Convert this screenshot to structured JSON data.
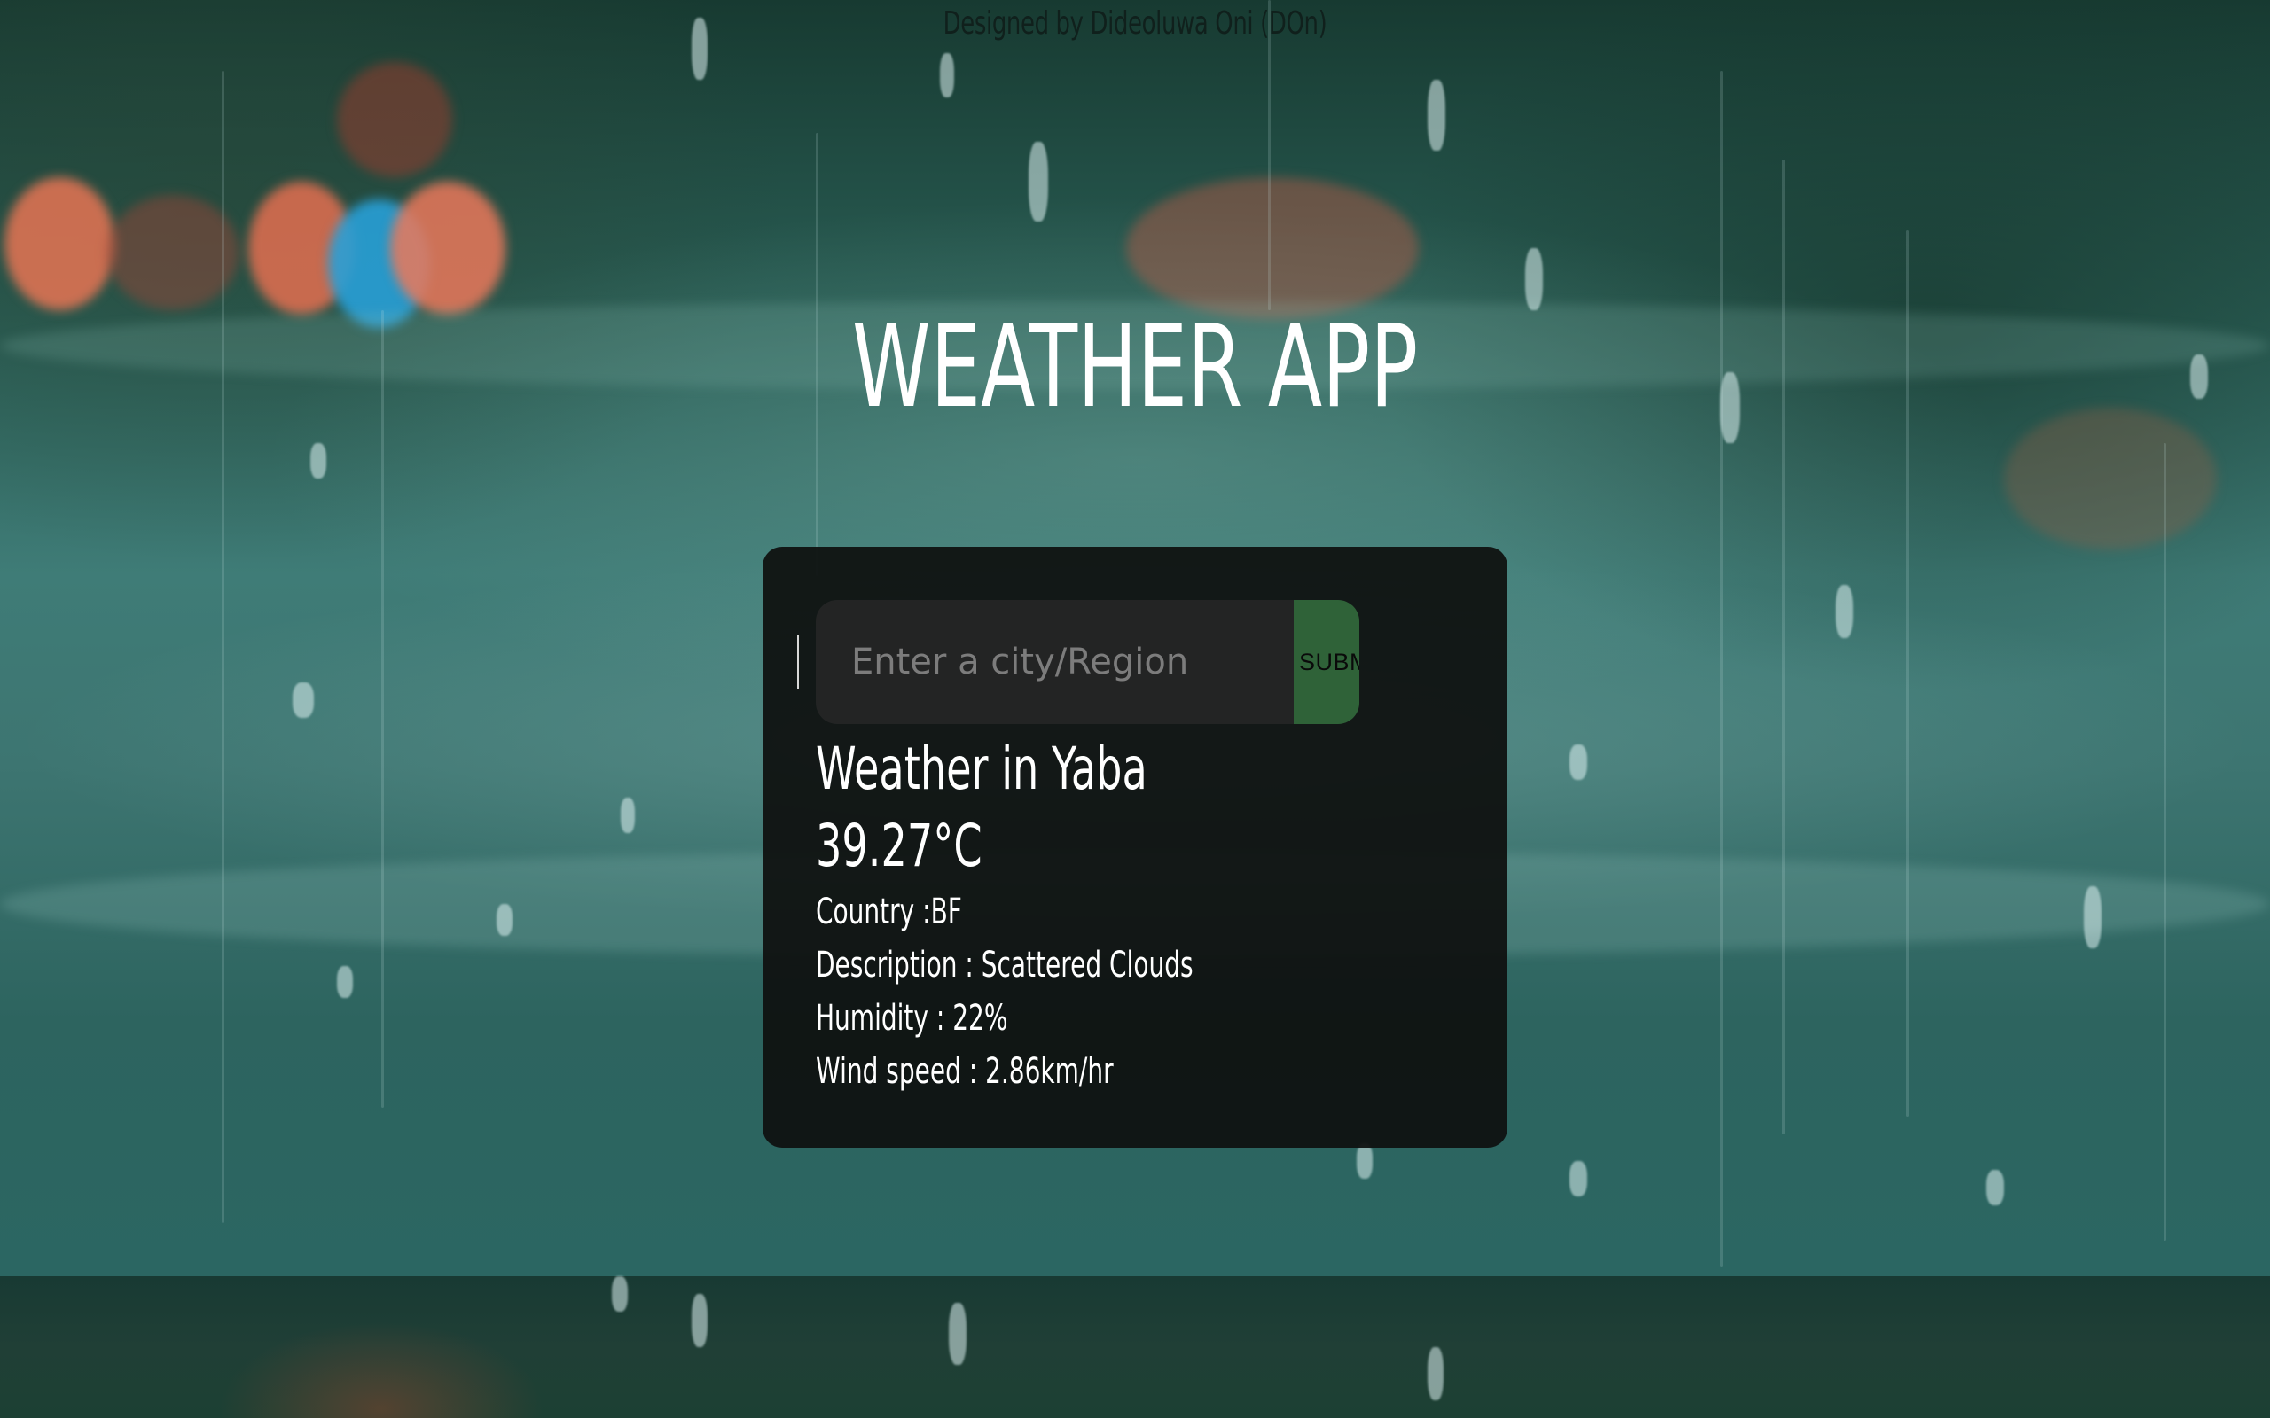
{
  "header": {
    "credit": "Designed by Dideoluwa Oni (DOn)"
  },
  "app": {
    "title": "WEATHER APP"
  },
  "search": {
    "value": "",
    "placeholder": "Enter a city/Region",
    "submit_label": "SUBMIT"
  },
  "weather": {
    "city_line": "Weather in Yaba",
    "temperature": "39.27°C",
    "country": "Country :BF",
    "description": "Description : Scattered Clouds",
    "humidity": "Humidity : 22%",
    "wind": "Wind speed : 2.86km/hr"
  },
  "colors": {
    "submit_bg": "#2f6238",
    "card_bg": "#0f1110",
    "input_bg": "#232424"
  }
}
